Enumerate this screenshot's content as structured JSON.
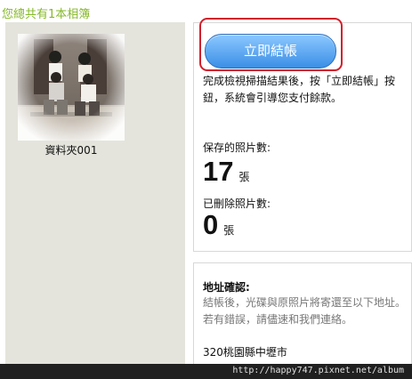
{
  "header": {
    "album_count_text": "您總共有1本相簿"
  },
  "album": {
    "folder_name": "資料夾001"
  },
  "checkout": {
    "button_label": "立即結帳",
    "instruction": "完成檢視掃描結果後，按「立即結帳」按鈕，系統會引導您支付餘款。"
  },
  "stats": {
    "saved_label": "保存的照片數:",
    "saved_count": "17",
    "saved_unit": "張",
    "deleted_label": "已刪除照片數:",
    "deleted_count": "0",
    "deleted_unit": "張"
  },
  "address": {
    "title": "地址確認:",
    "description": "結帳後，光碟與原照片將寄還至以下地址。若有錯誤，請儘速和我們連絡。",
    "value": "320桃園縣中壢市"
  },
  "footer": {
    "watermark": "http://happy747.pixnet.net/album"
  },
  "colors": {
    "accent_green": "#86b829",
    "button_blue": "#3b8fe6",
    "highlight_red": "#d21f2b"
  }
}
